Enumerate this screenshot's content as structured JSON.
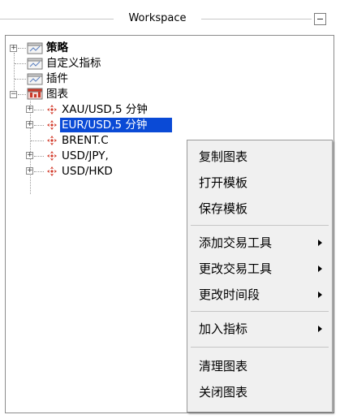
{
  "panel": {
    "title": "Workspace"
  },
  "tree": {
    "items": [
      {
        "label": "策略"
      },
      {
        "label": "自定义指标"
      },
      {
        "label": "插件"
      },
      {
        "label": "图表"
      },
      {
        "label": "XAU/USD,5 分钟"
      },
      {
        "label": "EUR/USD,5 分钟"
      },
      {
        "label": "BRENT.C"
      },
      {
        "label": "USD/JPY,"
      },
      {
        "label": "USD/HKD"
      }
    ],
    "expander_plus": "+",
    "expander_minus": "−"
  },
  "context_menu": {
    "items": [
      {
        "label": "复制图表"
      },
      {
        "label": "打开模板"
      },
      {
        "label": "保存模板"
      },
      {
        "label": "添加交易工具"
      },
      {
        "label": "更改交易工具"
      },
      {
        "label": "更改时间段"
      },
      {
        "label": "加入指标"
      },
      {
        "label": "清理图表"
      },
      {
        "label": "关闭图表"
      }
    ]
  },
  "colors": {
    "selection": "#0a4ad6",
    "menu_bg": "#f0f0f0",
    "icon_red": "#d23a2a"
  }
}
